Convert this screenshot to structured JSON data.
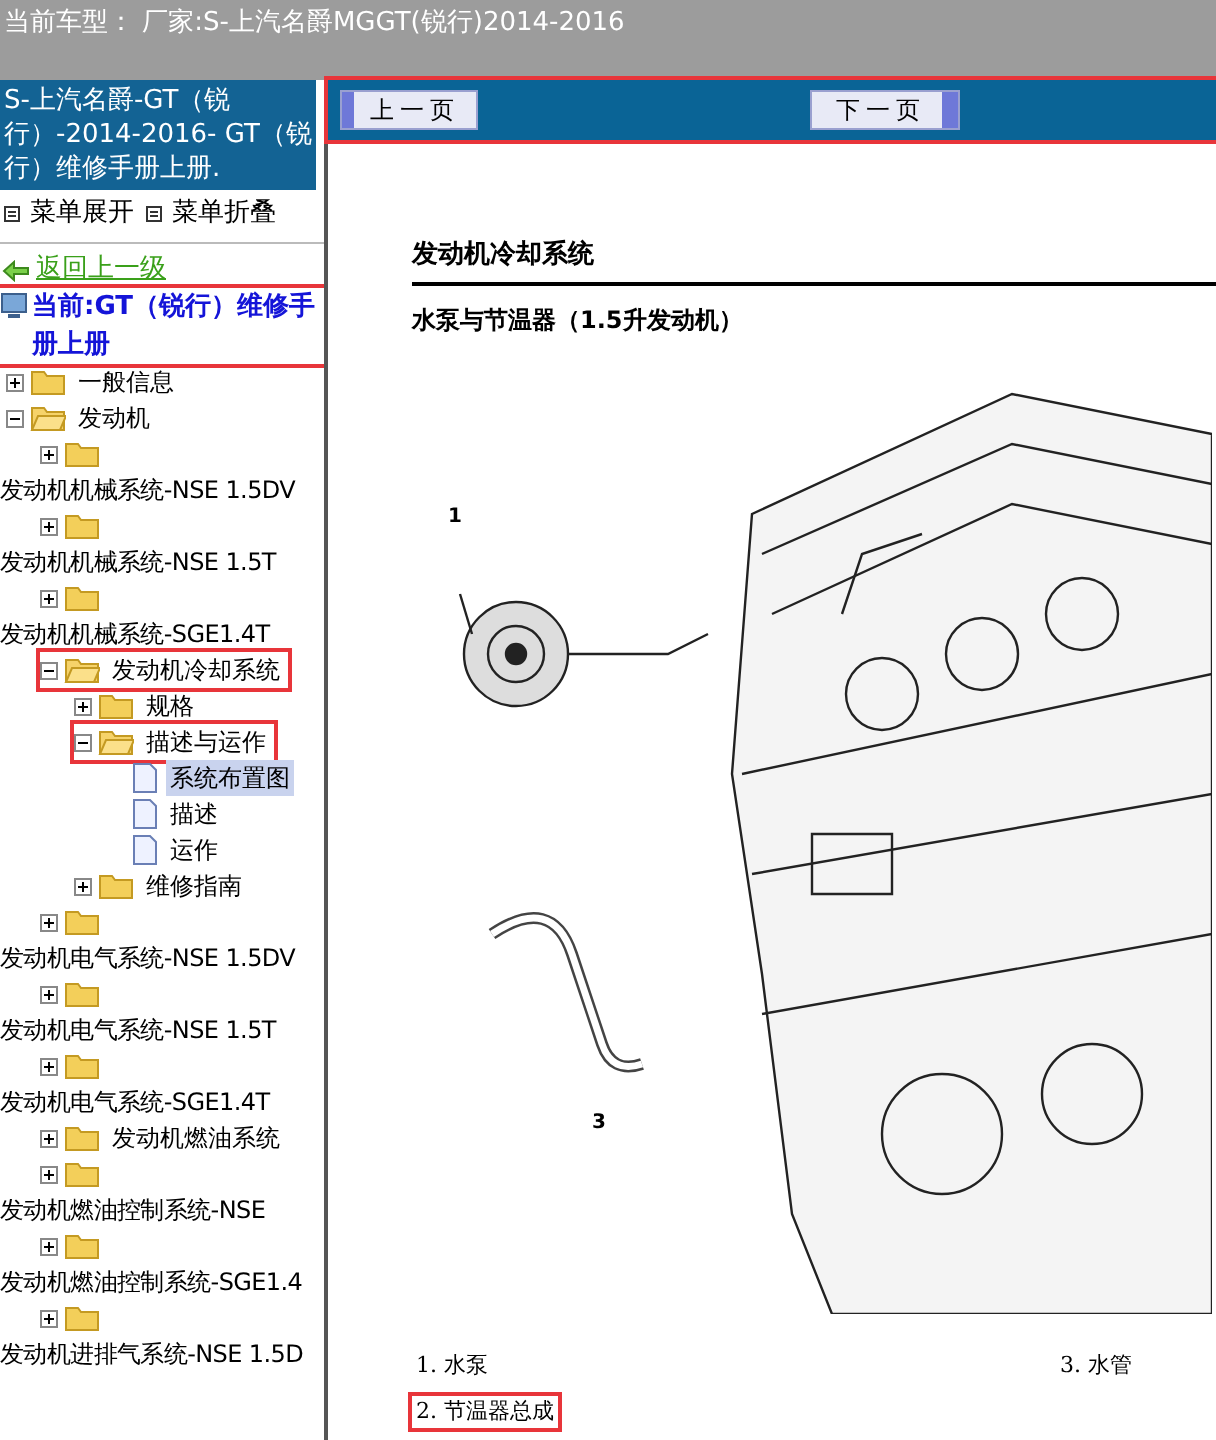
{
  "window": {
    "title": "当前车型： 厂家:S-上汽名爵MGGT(锐行)2014-2016"
  },
  "sidebar": {
    "header": "S-上汽名爵-GT（锐行）-2014-2016- GT（锐行）维修手册上册.",
    "menu": [
      {
        "label": "菜单展开"
      },
      {
        "label": "菜单折叠"
      }
    ],
    "back_link": "返回上一级",
    "current": {
      "label": "当前:GT（锐行）维修手册上册",
      "highlighted": true
    },
    "tree": [
      {
        "kind": "folder",
        "label": "一般信息",
        "expanded": false,
        "wrapped": false,
        "highlighted": false
      },
      {
        "kind": "folder",
        "label": "发动机",
        "expanded": true,
        "wrapped": false,
        "highlighted": false,
        "children": [
          {
            "kind": "folder",
            "label": "发动机机械系统-NSE 1.5DV",
            "expanded": false,
            "wrapped": true,
            "highlighted": false
          },
          {
            "kind": "folder",
            "label": "发动机机械系统-NSE 1.5T",
            "expanded": false,
            "wrapped": true,
            "highlighted": false
          },
          {
            "kind": "folder",
            "label": "发动机机械系统-SGE1.4T",
            "expanded": false,
            "wrapped": true,
            "highlighted": false
          },
          {
            "kind": "folder",
            "label": "发动机冷却系统",
            "expanded": true,
            "wrapped": false,
            "highlighted": true,
            "children": [
              {
                "kind": "folder",
                "label": "规格",
                "expanded": false,
                "wrapped": false,
                "highlighted": false
              },
              {
                "kind": "folder",
                "label": "描述与运作",
                "expanded": true,
                "wrapped": false,
                "highlighted": true,
                "children": [
                  {
                    "kind": "page",
                    "label": "系统布置图",
                    "selected": true
                  },
                  {
                    "kind": "page",
                    "label": "描述",
                    "selected": false
                  },
                  {
                    "kind": "page",
                    "label": "运作",
                    "selected": false
                  }
                ]
              },
              {
                "kind": "folder",
                "label": "维修指南",
                "expanded": false,
                "wrapped": false,
                "highlighted": false
              }
            ]
          },
          {
            "kind": "folder",
            "label": "发动机电气系统-NSE 1.5DV",
            "expanded": false,
            "wrapped": true,
            "highlighted": false
          },
          {
            "kind": "folder",
            "label": "发动机电气系统-NSE 1.5T",
            "expanded": false,
            "wrapped": true,
            "highlighted": false
          },
          {
            "kind": "folder",
            "label": "发动机电气系统-SGE1.4T",
            "expanded": false,
            "wrapped": true,
            "highlighted": false
          },
          {
            "kind": "folder",
            "label": "发动机燃油系统",
            "expanded": false,
            "wrapped": false,
            "highlighted": false
          },
          {
            "kind": "folder",
            "label": "发动机燃油控制系统-NSE",
            "expanded": false,
            "wrapped": true,
            "highlighted": false
          },
          {
            "kind": "folder",
            "label": "发动机燃油控制系统-SGE1.4",
            "expanded": false,
            "wrapped": true,
            "highlighted": false
          },
          {
            "kind": "folder",
            "label": "发动机进排气系统-NSE 1.5D",
            "expanded": false,
            "wrapped": true,
            "highlighted": false
          }
        ]
      }
    ]
  },
  "nav": {
    "highlighted": true,
    "prev": "上一页",
    "next": "下一页"
  },
  "document": {
    "title": "发动机冷却系统",
    "subtitle": "水泵与节温器（1.5升发动机）",
    "callouts": [
      "1",
      "3"
    ],
    "legend": [
      {
        "label": "1.  水泵",
        "highlighted": false
      },
      {
        "label": "3.  水管",
        "highlighted": false
      },
      {
        "label": "2.  节温器总成",
        "highlighted": true
      }
    ]
  }
}
